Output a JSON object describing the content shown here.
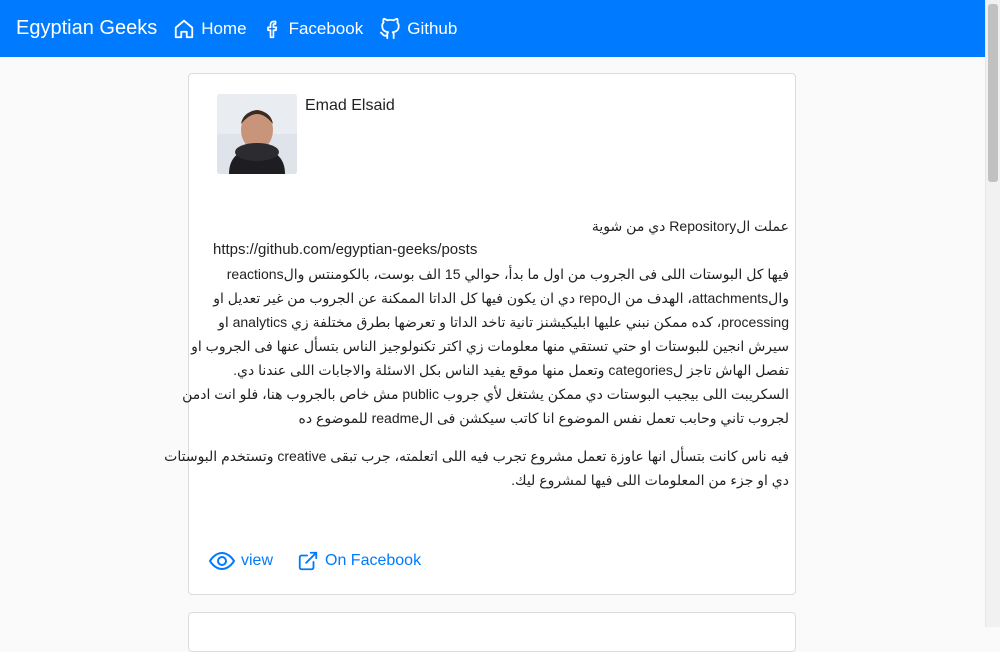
{
  "nav": {
    "brand": "Egyptian Geeks",
    "links": [
      {
        "label": "Home",
        "icon": "home-icon"
      },
      {
        "label": "Facebook",
        "icon": "facebook-icon"
      },
      {
        "label": "Github",
        "icon": "github-icon"
      }
    ]
  },
  "post": {
    "author": "Emad Elsaid",
    "lines": [
      "عملت الRepository دي من شوية",
      "https://github.com/egyptian-geeks/posts",
      "فيها كل البوستات اللى فى الجروب من اول ما بدأ، حوالي 15 الف بوست، بالكومنتس والreactions",
      "والattachments، الهدف من الrepo دي ان يكون فيها كل الداتا الممكنة عن الجروب من غير تعديل او",
      "processing، كده ممكن نبني عليها ابليكيشنز تانية تاخد الداتا و تعرضها بطرق مختلفة زي analytics او",
      "سيرش انجين للبوستات او حتي تستقي منها معلومات زي اكتر تكنولوجيز الناس بتسأل عنها فى الجروب او",
      "تفصل الهاش تاجز لcategories وتعمل منها موقع يفيد الناس بكل الاسئلة والاجابات اللى عندنا دي.",
      "السكريبت اللى بيجيب البوستات دي ممكن يشتغل لأي جروب public مش خاص بالجروب هنا، فلو انت ادمن",
      "لجروب تاني وحابب تعمل نفس الموضوع انا كاتب سيكشن فى الreadme للموضوع ده"
    ],
    "lines2": [
      "فيه ناس كانت بتسأل انها عاوزة تعمل مشروع تجرب فيه اللى اتعلمته، جرب تبقى creative وتستخدم البوستات",
      "دي او جزء من المعلومات اللى فيها لمشروع ليك."
    ],
    "actions": {
      "view": "view",
      "facebook": "On Facebook"
    }
  },
  "colors": {
    "navbar": "#007bff",
    "link": "#007bff"
  }
}
